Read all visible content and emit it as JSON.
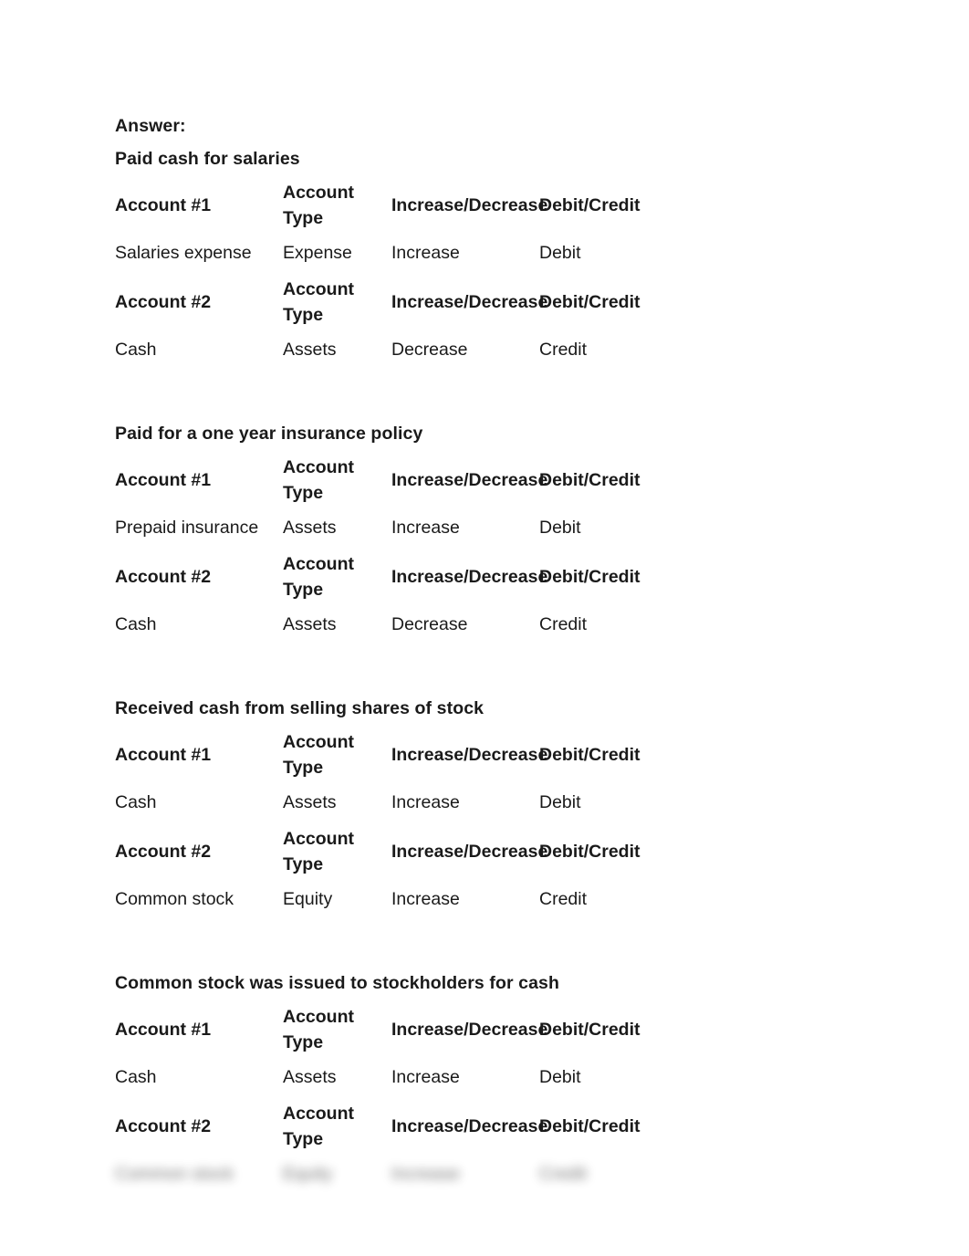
{
  "document": {
    "answer_label": "Answer:",
    "column_headers": {
      "account_1": "Account #1",
      "account_2": "Account #2",
      "account_type": "Account Type",
      "increase_decrease": "Increase/Decrease",
      "debit_credit": "Debit/Credit"
    },
    "sections": [
      {
        "heading": "Paid cash for salaries",
        "entries": [
          {
            "header_label": "Account #1",
            "header_type": "Account Type",
            "header_change": "Increase/Decrease",
            "header_dc": "Debit/Credit",
            "account": "Salaries expense",
            "type": "Expense",
            "change": "Increase",
            "dc": "Debit",
            "blurred": false
          },
          {
            "header_label": "Account #2",
            "header_type": "Account Type",
            "header_change": "Increase/Decrease",
            "header_dc": "Debit/Credit",
            "account": "Cash",
            "type": "Assets",
            "change": "Decrease",
            "dc": "Credit",
            "blurred": false
          }
        ]
      },
      {
        "heading": "Paid for a one year insurance policy",
        "entries": [
          {
            "header_label": "Account #1",
            "header_type": "Account Type",
            "header_change": "Increase/Decrease",
            "header_dc": "Debit/Credit",
            "account": "Prepaid insurance",
            "type": "Assets",
            "change": "Increase",
            "dc": "Debit",
            "blurred": false
          },
          {
            "header_label": "Account #2",
            "header_type": "Account Type",
            "header_change": "Increase/Decrease",
            "header_dc": "Debit/Credit",
            "account": "Cash",
            "type": "Assets",
            "change": "Decrease",
            "dc": "Credit",
            "blurred": false
          }
        ]
      },
      {
        "heading": "Received cash from selling shares of stock",
        "entries": [
          {
            "header_label": "Account #1",
            "header_type": "Account Type",
            "header_change": "Increase/Decrease",
            "header_dc": "Debit/Credit",
            "account": "Cash",
            "type": "Assets",
            "change": "Increase",
            "dc": "Debit",
            "blurred": false
          },
          {
            "header_label": "Account #2",
            "header_type": "Account Type",
            "header_change": "Increase/Decrease",
            "header_dc": "Debit/Credit",
            "account": "Common stock",
            "type": "Equity",
            "change": "Increase",
            "dc": "Credit",
            "blurred": false
          }
        ]
      },
      {
        "heading": "Common stock was issued to stockholders for cash",
        "entries": [
          {
            "header_label": "Account #1",
            "header_type": "Account Type",
            "header_change": "Increase/Decrease",
            "header_dc": "Debit/Credit",
            "account": "Cash",
            "type": "Assets",
            "change": "Increase",
            "dc": "Debit",
            "blurred": false
          },
          {
            "header_label": "Account #2",
            "header_type": "Account Type",
            "header_change": "Increase/Decrease",
            "header_dc": "Debit/Credit",
            "account": "Common stock",
            "type": "Equity",
            "change": "Increase",
            "dc": "Credit",
            "blurred": true
          }
        ]
      }
    ]
  },
  "colors": {
    "page_background": "#ffffff",
    "text": "#1a1a1a"
  }
}
